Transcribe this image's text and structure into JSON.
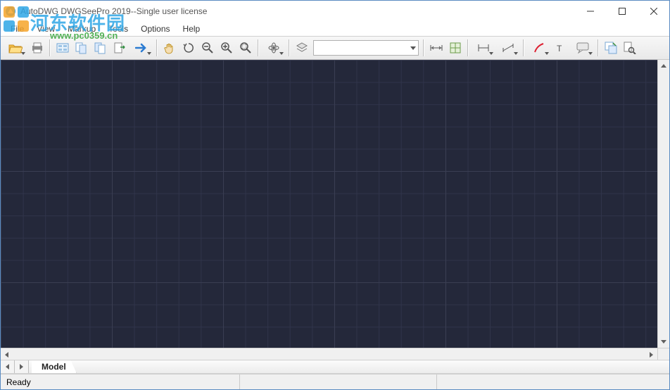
{
  "title": "AutoDWG DWGSeePro 2019--Single user license",
  "menu": {
    "file": "File",
    "view": "View",
    "markup": "Markup",
    "tools": "Tools",
    "options": "Options",
    "help": "Help"
  },
  "watermark": {
    "text": "河东软件园",
    "url": "www.pc0359.cn"
  },
  "toolbar_icons": {
    "open": "open-icon",
    "print": "print-icon",
    "browse": "browse-icon",
    "compare1": "compare-a-icon",
    "compare2": "compare-b-icon",
    "export": "export-icon",
    "nav": "arrow-right-icon",
    "pan": "pan-hand-icon",
    "rotate": "rotate-icon",
    "zoom_out": "zoom-out-icon",
    "zoom_in": "zoom-in-icon",
    "zoom_window": "zoom-window-icon",
    "view3d": "view3d-icon",
    "layers_toggle": "layers-icon",
    "measure_dist": "measure-distance-icon",
    "measure_area": "measure-area-icon",
    "dim_linear": "dimension-linear-icon",
    "dim_aligned": "dimension-aligned-icon",
    "markup_pen": "markup-pen-icon",
    "text": "text-tool-icon",
    "comment": "comment-icon",
    "copy_view": "copy-view-icon",
    "search": "search-icon"
  },
  "layer_selected": "",
  "tabs": {
    "model": "Model"
  },
  "status": {
    "ready": "Ready",
    "coords": ""
  }
}
